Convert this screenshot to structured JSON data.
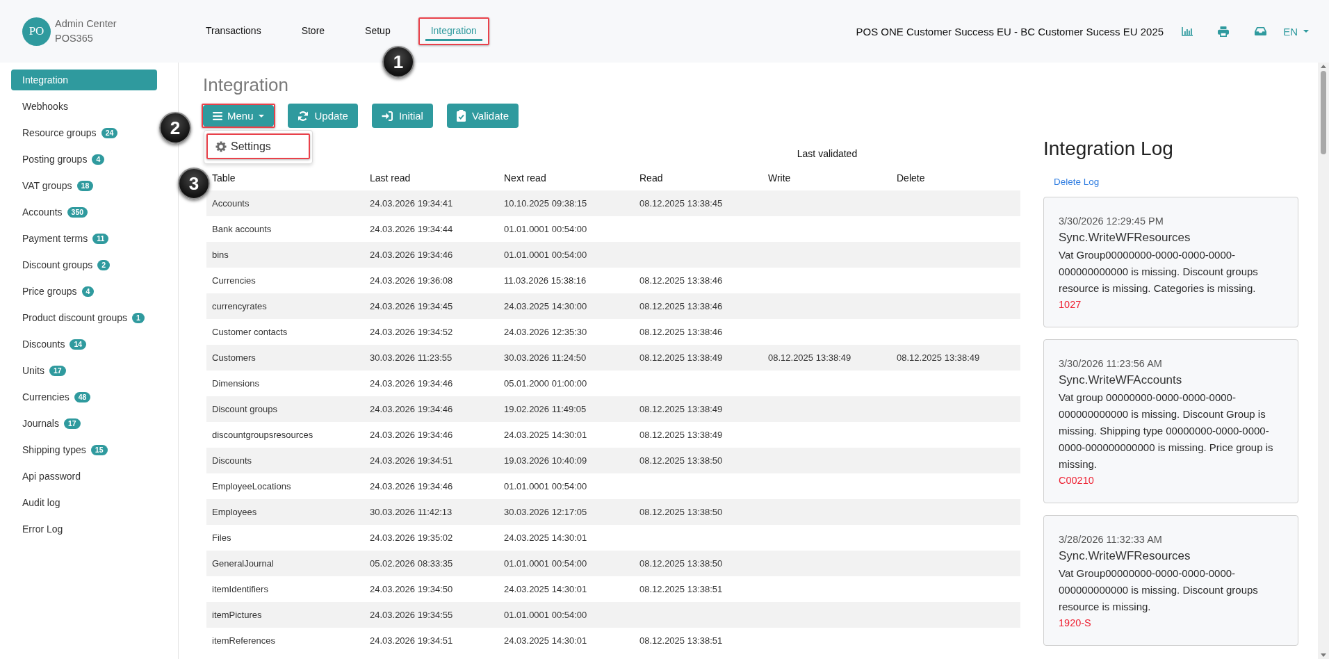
{
  "header": {
    "logo_initials": "PO",
    "app_name": "Admin Center",
    "app_subtitle": "POS365",
    "nav": [
      {
        "label": "Transactions",
        "selected": false,
        "highlighted": false
      },
      {
        "label": "Store",
        "selected": false,
        "highlighted": false
      },
      {
        "label": "Setup",
        "selected": false,
        "highlighted": false
      },
      {
        "label": "Integration",
        "selected": true,
        "highlighted": true
      }
    ],
    "company": "POS ONE Customer Success EU - BC Customer Sucess EU 2025",
    "language": "EN"
  },
  "sidebar": {
    "items": [
      {
        "label": "Integration",
        "selected": true
      },
      {
        "label": "Webhooks",
        "selected": false
      },
      {
        "label": "Resource groups",
        "badge": "24",
        "selected": false
      },
      {
        "label": "Posting groups",
        "badge": "4",
        "selected": false
      },
      {
        "label": "VAT groups",
        "badge": "18",
        "selected": false
      },
      {
        "label": "Accounts",
        "badge": "350",
        "selected": false
      },
      {
        "label": "Payment terms",
        "badge": "11",
        "selected": false
      },
      {
        "label": "Discount groups",
        "badge": "2",
        "selected": false
      },
      {
        "label": "Price groups",
        "badge": "4",
        "selected": false
      },
      {
        "label": "Product discount groups",
        "badge": "1",
        "selected": false
      },
      {
        "label": "Discounts",
        "badge": "14",
        "selected": false
      },
      {
        "label": "Units",
        "badge": "17",
        "selected": false
      },
      {
        "label": "Currencies",
        "badge": "48",
        "selected": false
      },
      {
        "label": "Journals",
        "badge": "17",
        "selected": false
      },
      {
        "label": "Shipping types",
        "badge": "15",
        "selected": false
      },
      {
        "label": "Api password",
        "selected": false
      },
      {
        "label": "Audit log",
        "selected": false
      },
      {
        "label": "Error Log",
        "selected": false
      }
    ]
  },
  "page": {
    "title": "Integration",
    "menu": {
      "label": "Menu",
      "expanded": true,
      "highlighted": true,
      "items": [
        {
          "label": "Settings",
          "highlighted": true
        }
      ]
    },
    "actions": [
      {
        "label": "Update",
        "highlighted": false
      },
      {
        "label": "Initial",
        "highlighted": false
      },
      {
        "label": "Validate",
        "highlighted": false
      }
    ]
  },
  "table": {
    "column_group": "Last validated",
    "columns": [
      "Table",
      "Last read",
      "Next read",
      "Read",
      "Write",
      "Delete"
    ],
    "rows": [
      {
        "table": "Accounts",
        "last_read": "24.03.2026 19:34:41",
        "next_read": "10.10.2025 09:38:15",
        "read": "08.12.2025 13:38:45"
      },
      {
        "table": "Bank accounts",
        "last_read": "24.03.2026 19:34:44",
        "next_read": "01.01.0001 00:54:00"
      },
      {
        "table": "bins",
        "last_read": "24.03.2026 19:34:46",
        "next_read": "01.01.0001 00:54:00"
      },
      {
        "table": "Currencies",
        "last_read": "24.03.2026 19:36:08",
        "next_read": "11.03.2026 15:38:16",
        "read": "08.12.2025 13:38:46"
      },
      {
        "table": "currencyrates",
        "last_read": "24.03.2026 19:34:45",
        "next_read": "24.03.2025 14:30:00",
        "read": "08.12.2025 13:38:46"
      },
      {
        "table": "Customer contacts",
        "last_read": "24.03.2026 19:34:52",
        "next_read": "24.03.2026 12:35:30",
        "read": "08.12.2025 13:38:46"
      },
      {
        "table": "Customers",
        "last_read": "30.03.2026 11:23:55",
        "next_read": "30.03.2026 11:24:50",
        "read": "08.12.2025 13:38:49",
        "write": "08.12.2025 13:38:49",
        "delete": "08.12.2025 13:38:49"
      },
      {
        "table": "Dimensions",
        "last_read": "24.03.2026 19:34:46",
        "next_read": "05.01.2000 01:00:00"
      },
      {
        "table": "Discount groups",
        "last_read": "24.03.2026 19:34:46",
        "next_read": "19.02.2026 11:49:05",
        "read": "08.12.2025 13:38:49"
      },
      {
        "table": "discountgroupsresources",
        "last_read": "24.03.2026 19:34:46",
        "next_read": "24.03.2025 14:30:01",
        "read": "08.12.2025 13:38:49"
      },
      {
        "table": "Discounts",
        "last_read": "24.03.2026 19:34:51",
        "next_read": "19.03.2026 10:40:09",
        "read": "08.12.2025 13:38:50"
      },
      {
        "table": "EmployeeLocations",
        "last_read": "24.03.2026 19:34:46",
        "next_read": "01.01.0001 00:54:00"
      },
      {
        "table": "Employees",
        "last_read": "30.03.2026 11:42:13",
        "next_read": "30.03.2026 12:17:05",
        "read": "08.12.2025 13:38:50"
      },
      {
        "table": "Files",
        "last_read": "24.03.2026 19:35:02",
        "next_read": "24.03.2025 14:30:01"
      },
      {
        "table": "GeneralJournal",
        "last_read": "05.02.2026 08:33:35",
        "next_read": "01.01.0001 00:54:00",
        "read": "08.12.2025 13:38:50"
      },
      {
        "table": "itemIdentifiers",
        "last_read": "24.03.2026 19:34:50",
        "next_read": "24.03.2025 14:30:01",
        "read": "08.12.2025 13:38:51"
      },
      {
        "table": "itemPictures",
        "last_read": "24.03.2026 19:34:55",
        "next_read": "01.01.0001 00:54:00"
      },
      {
        "table": "itemReferences",
        "last_read": "24.03.2026 19:34:51",
        "next_read": "24.03.2025 14:30:01",
        "read": "08.12.2025 13:38:51"
      }
    ]
  },
  "log": {
    "title": "Integration Log",
    "delete_action": "Delete Log",
    "entries": [
      {
        "time": "3/30/2026 12:29:45 PM",
        "source": "Sync.WriteWFResources",
        "message": "Vat Group00000000-0000-0000-0000-000000000000 is missing. Discount groups resource is missing. Categories is missing.",
        "code": "1027"
      },
      {
        "time": "3/30/2026 11:23:56 AM",
        "source": "Sync.WriteWFAccounts",
        "message": "Vat group 00000000-0000-0000-0000-000000000000 is missing. Discount Group is missing. Shipping type 00000000-0000-0000-0000-000000000000 is missing. Price group is missing.",
        "code": "C00210"
      },
      {
        "time": "3/28/2026 11:32:33 AM",
        "source": "Sync.WriteWFResources",
        "message": "Vat Group00000000-0000-0000-0000-000000000000 is missing. Discount groups resource is missing.",
        "code": "1920-S"
      }
    ]
  },
  "callouts": [
    {
      "number": "1"
    },
    {
      "number": "2"
    },
    {
      "number": "3"
    }
  ]
}
